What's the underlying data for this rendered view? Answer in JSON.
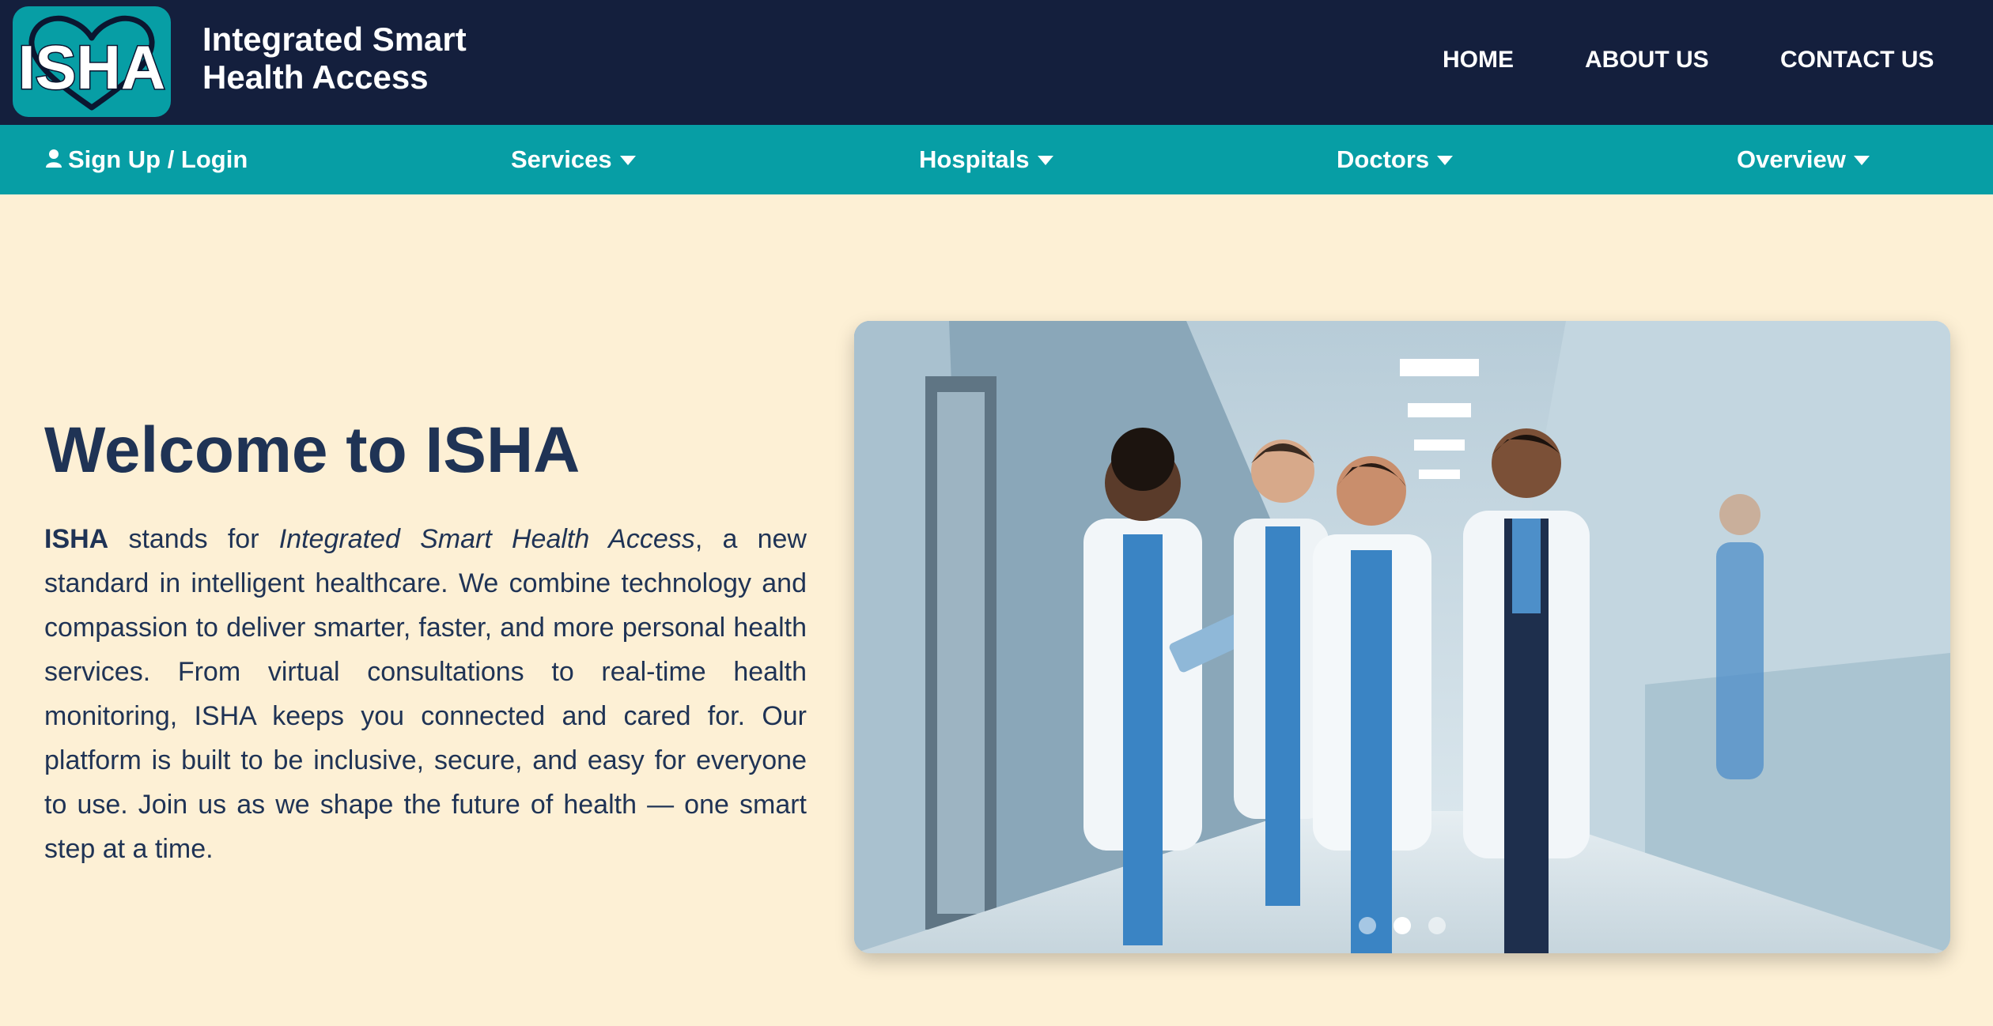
{
  "logo": {
    "text": "ISHA",
    "icon": "heart-outline-icon"
  },
  "header": {
    "brand_title": "Integrated Smart Health Access",
    "nav": {
      "home": "HOME",
      "about": "ABOUT US",
      "contact": "CONTACT US"
    }
  },
  "subnav": {
    "login": "Sign Up / Login",
    "services": "Services",
    "hospitals": "Hospitals",
    "doctors": "Doctors",
    "overview": "Overview"
  },
  "hero": {
    "title": "Welcome to ISHA",
    "intro_bold": "ISHA",
    "intro_stands_for": " stands for ",
    "intro_italic": "Integrated Smart Health Access",
    "body": ", a new standard in intelligent healthcare. We combine technology and compassion to deliver smarter, faster, and more personal health services. From virtual consultations to real-time health monitoring, ISHA keeps you connected and cared for. Our platform is built to be inclusive, secure, and easy for everyone to use. Join us as we shape the future of health — one smart step at a time."
  },
  "carousel": {
    "slide_count": 3,
    "active_index": 1
  },
  "colors": {
    "header_bg": "#141f3d",
    "accent_teal": "#079ea5",
    "page_bg": "#fdf0d5",
    "heading_text": "#1f3355"
  }
}
